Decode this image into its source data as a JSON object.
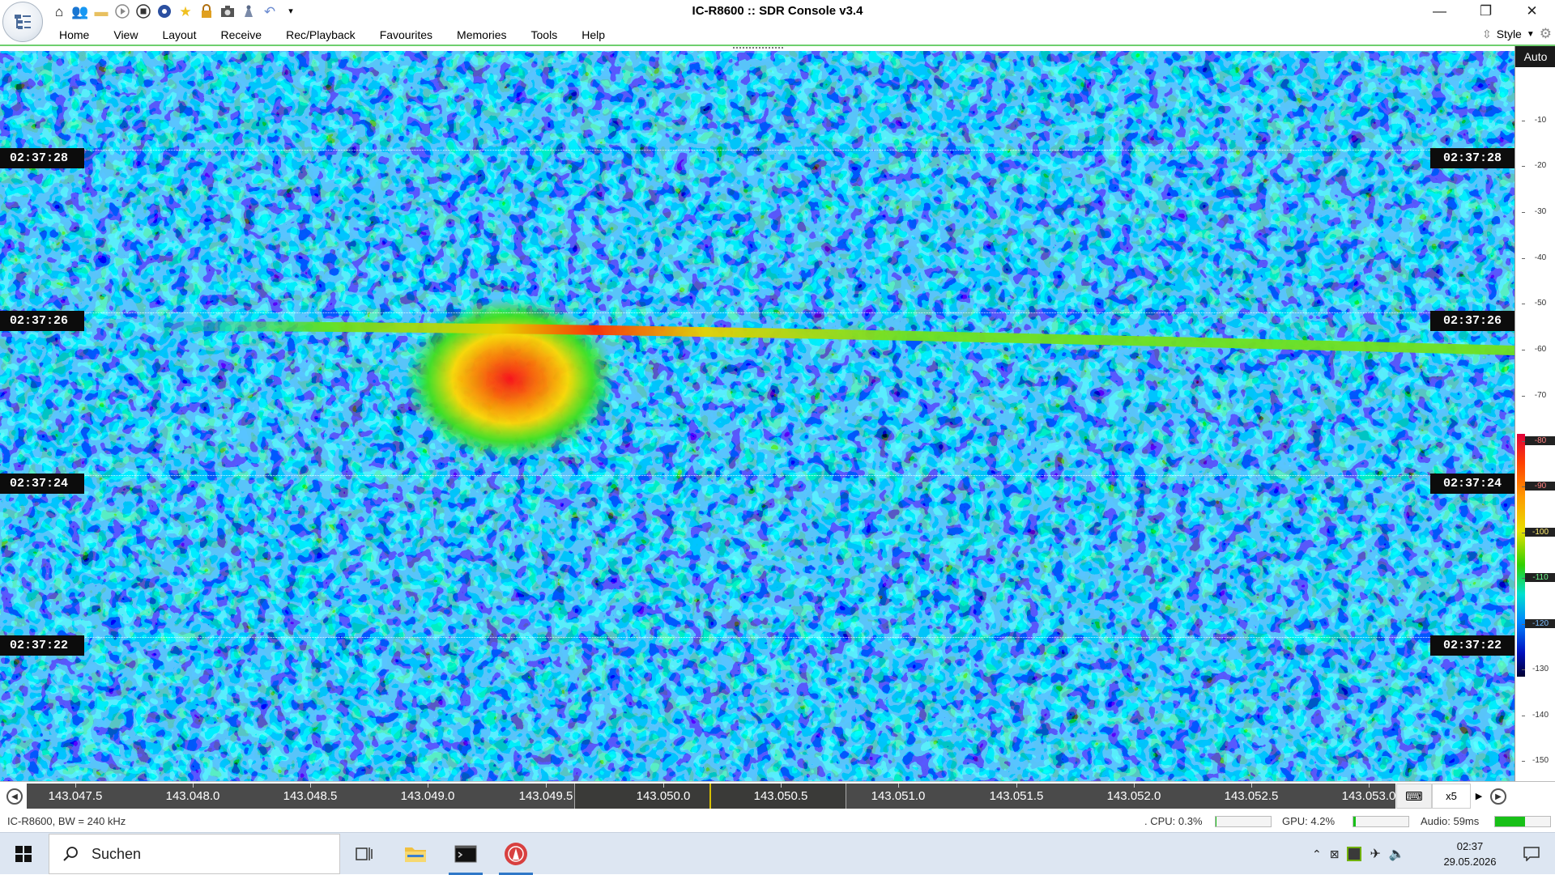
{
  "window": {
    "title": "IC-R8600 :: SDR Console v3.4",
    "minimize_glyph": "—",
    "restore_glyph": "❐",
    "close_glyph": "✕"
  },
  "quick_access_icons": [
    "home-icon",
    "users-icon",
    "folder-icon",
    "play-icon",
    "stop-icon",
    "record-icon",
    "favourite-star-icon",
    "lock-icon",
    "camera-icon",
    "satellite-icon",
    "undo-icon",
    "customize-dropdown-icon"
  ],
  "menu": {
    "items": [
      "Home",
      "View",
      "Layout",
      "Receive",
      "Rec/Playback",
      "Favourites",
      "Memories",
      "Tools",
      "Help"
    ],
    "style_label": "Style"
  },
  "waterfall": {
    "timestamps": [
      "02:37:28",
      "02:37:26",
      "02:37:24",
      "02:37:22"
    ]
  },
  "scale": {
    "auto_label": "Auto",
    "ticks": [
      "-10",
      "-20",
      "-30",
      "-40",
      "-50",
      "-60",
      "-70",
      "-80",
      "-90",
      "-100",
      "-110",
      "-120",
      "-130",
      "-140",
      "-150"
    ]
  },
  "frequency_axis": {
    "labels": [
      "143.047.5",
      "143.048.0",
      "143.048.5",
      "143.049.0",
      "143.049.5",
      "143.050.0",
      "143.050.5",
      "143.051.0",
      "143.051.5",
      "143.052.0",
      "143.052.5",
      "143.053.0"
    ],
    "zoom": "x5"
  },
  "status": {
    "radio": "IC-R8600, BW = 240 kHz",
    "cpu": ". CPU: 0.3%",
    "cpu_level": 0.003,
    "gpu": "GPU: 4.2%",
    "gpu_level": 0.042,
    "audio": "Audio: 59ms",
    "audio_level": 0.55
  },
  "taskbar": {
    "search_placeholder": "Suchen",
    "time": "02:37",
    "date": "29.05.2026"
  },
  "colors": {
    "accent_green": "#6fcf6f",
    "meter_green": "#18c018",
    "taskbar_bg": "#dde6f2",
    "waterfall_bg": "#0a2fd8"
  }
}
